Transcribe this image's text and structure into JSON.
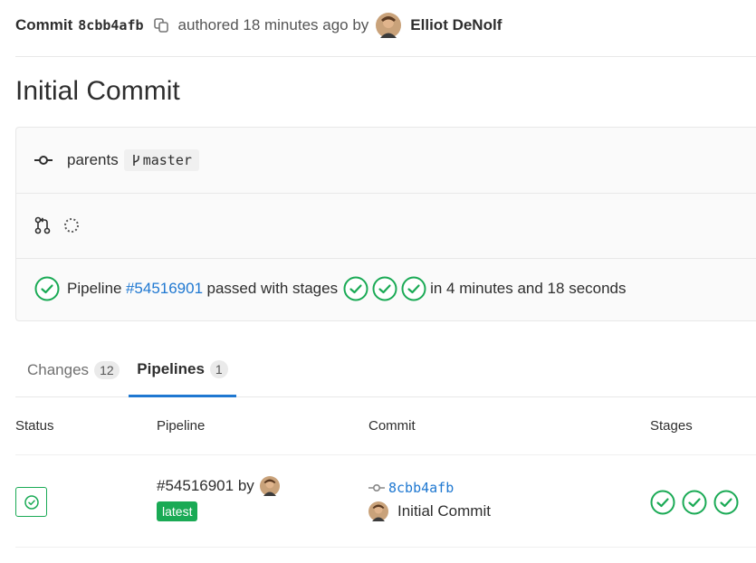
{
  "header": {
    "commit_label": "Commit",
    "sha": "8cbb4afb",
    "authored_text": "authored 18 minutes ago by",
    "author_name": "Elliot DeNolf"
  },
  "title": "Initial Commit",
  "info": {
    "parents_label": "parents",
    "branch": "master",
    "pipeline_prefix": "Pipeline",
    "pipeline_id": "#54516901",
    "passed_text": "passed with stages",
    "duration_text": "in 4 minutes and 18 seconds"
  },
  "tabs": [
    {
      "label": "Changes",
      "count": "12"
    },
    {
      "label": "Pipelines",
      "count": "1"
    }
  ],
  "table": {
    "headers": [
      "Status",
      "Pipeline",
      "Commit",
      "Stages"
    ],
    "row": {
      "pipeline_id": "#54516901",
      "by_text": "by",
      "badge": "latest",
      "commit_sha": "8cbb4afb",
      "commit_message": "Initial Commit"
    }
  },
  "colors": {
    "success": "#1aaa55",
    "link": "#1f78d1",
    "active_tab": "#1f78d1"
  }
}
